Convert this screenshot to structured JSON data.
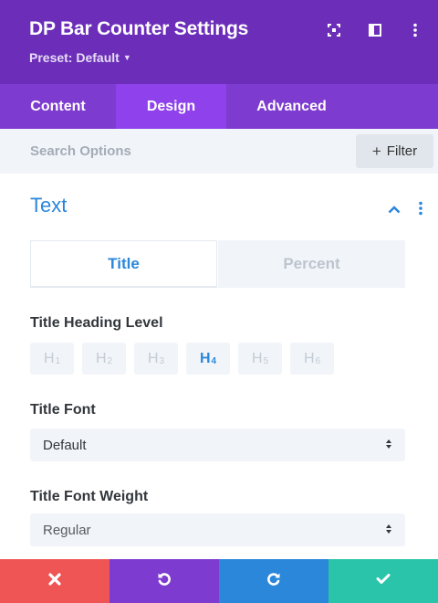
{
  "header": {
    "title": "DP Bar Counter Settings",
    "preset_label": "Preset: Default",
    "background": "#6c2eb9",
    "icons": [
      "fullscreen-icon",
      "split-view-icon",
      "more-options-icon"
    ]
  },
  "tabs": [
    {
      "label": "Content",
      "active": false
    },
    {
      "label": "Design",
      "active": true
    },
    {
      "label": "Advanced",
      "active": false
    }
  ],
  "search": {
    "placeholder": "Search Options",
    "filter_label": "Filter"
  },
  "section": {
    "title": "Text",
    "accent": "#2b87da"
  },
  "subtabs": [
    {
      "label": "Title",
      "active": true
    },
    {
      "label": "Percent",
      "active": false
    }
  ],
  "heading_level": {
    "label": "Title Heading Level",
    "options": [
      {
        "letter": "H",
        "num": "1"
      },
      {
        "letter": "H",
        "num": "2"
      },
      {
        "letter": "H",
        "num": "3"
      },
      {
        "letter": "H",
        "num": "4"
      },
      {
        "letter": "H",
        "num": "5"
      },
      {
        "letter": "H",
        "num": "6"
      }
    ],
    "selected": "H4"
  },
  "title_font": {
    "label": "Title Font",
    "value": "Default"
  },
  "title_font_weight": {
    "label": "Title Font Weight",
    "value": "Regular"
  },
  "footer": {
    "buttons": [
      {
        "name": "cancel",
        "icon": "close-icon",
        "color": "#ef5555"
      },
      {
        "name": "undo",
        "icon": "undo-icon",
        "color": "#7e3bd0"
      },
      {
        "name": "redo",
        "icon": "redo-icon",
        "color": "#2b87da"
      },
      {
        "name": "save",
        "icon": "check-icon",
        "color": "#29c4a9"
      }
    ]
  }
}
